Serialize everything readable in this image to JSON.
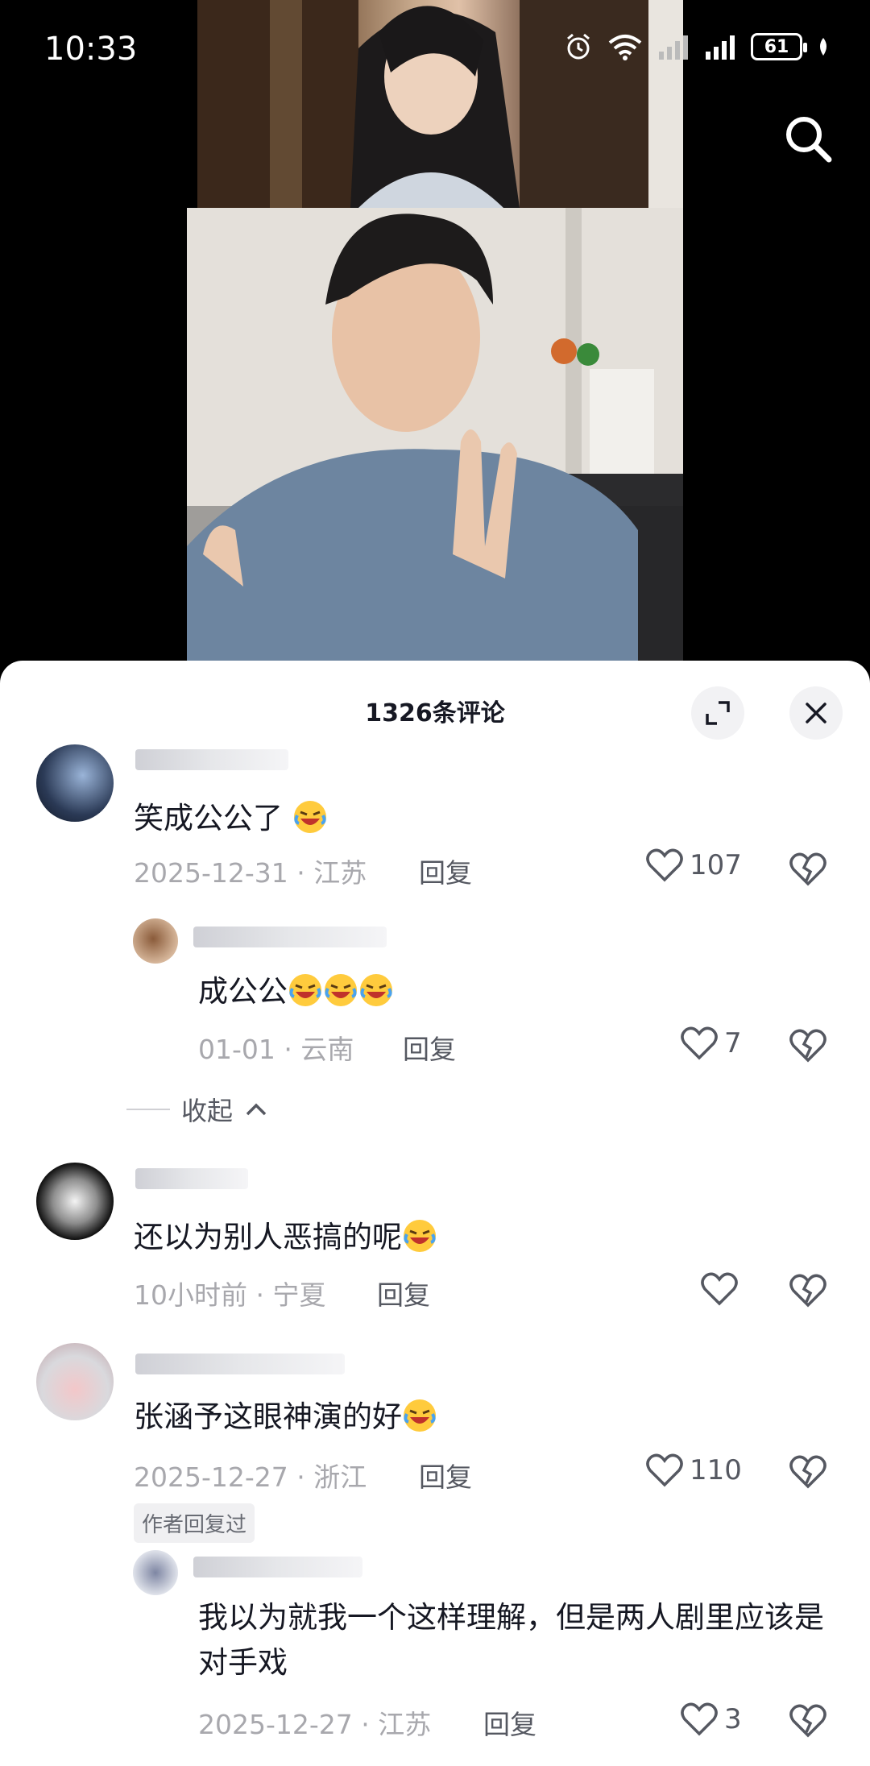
{
  "status_bar": {
    "time": "10:33",
    "battery": "61"
  },
  "icons": {
    "search": "search-icon",
    "expand": "expand-icon",
    "close": "close-icon",
    "heart": "heart-icon",
    "dislike": "broken-heart-icon",
    "chevron": "chevron-up-icon",
    "emoji": "crying-laughing-emoji"
  },
  "comments_panel": {
    "title": "1326条评论",
    "collapse_label": "收起",
    "author_replied_badge": "作者回复过",
    "comments": [
      {
        "text": "笑成公公了",
        "date": "2025-12-31",
        "location": "江苏",
        "reply_label": "回复",
        "likes": "107"
      },
      {
        "text": "成公公",
        "date": "01-01",
        "location": "云南",
        "reply_label": "回复",
        "likes": "7"
      },
      {
        "text": "还以为别人恶搞的呢",
        "date": "10小时前",
        "location": "宁夏",
        "reply_label": "回复",
        "likes": ""
      },
      {
        "text": "张涵予这眼神演的好",
        "date": "2025-12-27",
        "location": "浙江",
        "reply_label": "回复",
        "likes": "110"
      },
      {
        "text": "我以为就我一个这样理解，但是两人剧里应该是对手戏",
        "date": "2025-12-27",
        "location": "江苏",
        "reply_label": "回复",
        "likes": "3"
      }
    ]
  },
  "colors": {
    "panel_bg": "#ffffff",
    "primary_text": "#161823",
    "secondary_text": "#a8a8ad",
    "icon_gray": "#555861"
  }
}
